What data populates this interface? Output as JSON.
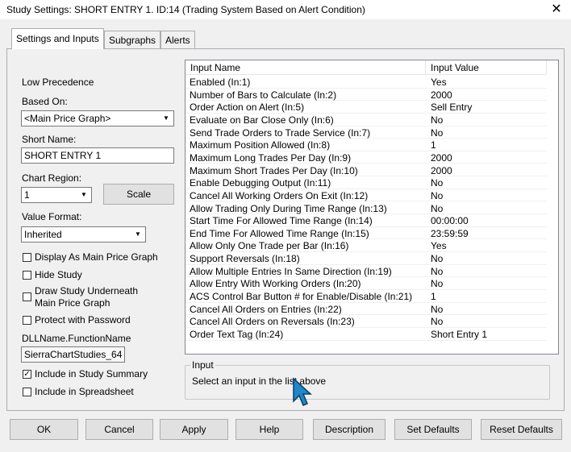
{
  "window": {
    "title": "Study Settings: SHORT ENTRY 1. ID:14 (Trading System Based on Alert Condition)",
    "close": "✕"
  },
  "tabs": [
    {
      "label": "Settings and Inputs"
    },
    {
      "label": "Subgraphs"
    },
    {
      "label": "Alerts"
    }
  ],
  "left": {
    "precedence": "Low Precedence",
    "based_on_label": "Based On:",
    "based_on_value": "<Main Price Graph>",
    "short_name_label": "Short Name:",
    "short_name_value": "SHORT ENTRY 1",
    "chart_region_label": "Chart Region:",
    "chart_region_value": "1",
    "scale_button": "Scale",
    "value_format_label": "Value Format:",
    "value_format_value": "Inherited",
    "checkboxes": [
      {
        "label": "Display As Main Price Graph",
        "checked": false
      },
      {
        "label": "Hide Study",
        "checked": false
      },
      {
        "label": "Draw Study Underneath",
        "label2": "Main Price Graph",
        "checked": false
      },
      {
        "label": "Protect with Password",
        "checked": false
      }
    ],
    "dll_label": "DLLName.FunctionName",
    "dll_value": "SierraChartStudies_64",
    "checkboxes2": [
      {
        "label": "Include in Study Summary",
        "checked": true
      },
      {
        "label": "Include in Spreadsheet",
        "checked": false
      }
    ]
  },
  "inputs": {
    "columns": [
      "Input Name",
      "Input Value"
    ],
    "rows": [
      {
        "name": "Enabled  (In:1)",
        "value": "Yes"
      },
      {
        "name": "Number of Bars to Calculate  (In:2)",
        "value": "2000"
      },
      {
        "name": "Order Action on Alert  (In:5)",
        "value": "Sell Entry"
      },
      {
        "name": "Evaluate on Bar Close Only  (In:6)",
        "value": "No"
      },
      {
        "name": "Send Trade Orders to Trade Service  (In:7)",
        "value": "No"
      },
      {
        "name": "Maximum Position Allowed  (In:8)",
        "value": "1"
      },
      {
        "name": "Maximum Long Trades Per Day  (In:9)",
        "value": "2000"
      },
      {
        "name": "Maximum Short Trades Per Day  (In:10)",
        "value": "2000"
      },
      {
        "name": "Enable Debugging Output  (In:11)",
        "value": "No"
      },
      {
        "name": "Cancel All Working Orders On Exit  (In:12)",
        "value": "No"
      },
      {
        "name": "Allow Trading Only During Time Range  (In:13)",
        "value": "No"
      },
      {
        "name": "Start Time For Allowed Time Range  (In:14)",
        "value": "00:00:00"
      },
      {
        "name": "End Time For Allowed Time Range  (In:15)",
        "value": "23:59:59"
      },
      {
        "name": "Allow Only One Trade per Bar  (In:16)",
        "value": "Yes"
      },
      {
        "name": "Support Reversals  (In:18)",
        "value": "No"
      },
      {
        "name": "Allow Multiple Entries In Same Direction  (In:19)",
        "value": "No"
      },
      {
        "name": "Allow Entry With Working Orders  (In:20)",
        "value": "No"
      },
      {
        "name": "ACS Control Bar Button # for Enable/Disable  (In:21)",
        "value": "1"
      },
      {
        "name": "Cancel All Orders on Entries  (In:22)",
        "value": "No"
      },
      {
        "name": "Cancel All Orders on Reversals  (In:23)",
        "value": "No"
      },
      {
        "name": "Order Text Tag  (In:24)",
        "value": "Short Entry 1"
      }
    ]
  },
  "input_group": {
    "title": "Input",
    "text": "Select an input in the list above"
  },
  "buttons": [
    "OK",
    "Cancel",
    "Apply",
    "Help",
    "Description",
    "Set Defaults",
    "Reset Defaults"
  ]
}
